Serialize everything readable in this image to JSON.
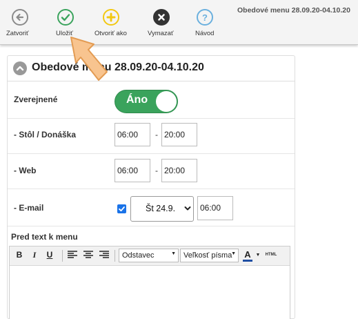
{
  "toolbar": {
    "buttons": [
      {
        "label": "Zatvoriť",
        "icon": "arrow-left-icon",
        "color": "#888888"
      },
      {
        "label": "Uložiť",
        "icon": "checkmark-icon",
        "color": "#3aa35c"
      },
      {
        "label": "Otvoriť ako",
        "icon": "plus-icon",
        "color": "#f2c811"
      },
      {
        "label": "Vymazať",
        "icon": "close-icon",
        "color": "#333333"
      },
      {
        "label": "Návod",
        "icon": "question-icon",
        "color": "#6ab0de"
      }
    ],
    "page_title": "Obedové menu 28.09.20-04.10.20"
  },
  "panel": {
    "title": "Obedové menu 28.09.20-04.10.20"
  },
  "form": {
    "published_label": "Zverejnené",
    "published_value": "Áno",
    "published_on": true,
    "table_label": "- Stôl / Donáška",
    "table_from": "06:00",
    "table_to": "20:00",
    "web_label": "- Web",
    "web_from": "06:00",
    "web_to": "20:00",
    "email_label": "- E-mail",
    "email_checked": true,
    "email_day": "Št 24.9.",
    "email_time": "06:00",
    "dash": "-"
  },
  "editor": {
    "label": "Pred text k menu",
    "bold": "B",
    "italic": "I",
    "underline": "U",
    "format_value": "Odstavec",
    "size_value": "Veľkosť písma",
    "color_letter": "A",
    "html_label": "HTML"
  },
  "colors": {
    "accent_green": "#3aa35c",
    "checkbox_blue": "#1a73e8"
  }
}
